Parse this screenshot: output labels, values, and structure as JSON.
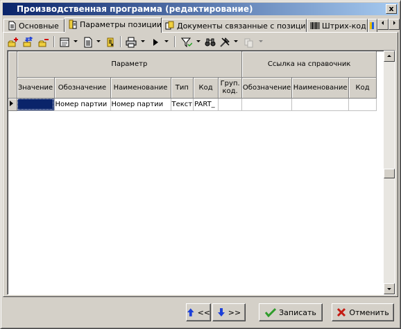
{
  "window": {
    "title": "Производственная программа (редактирование)",
    "close_glyph": "x"
  },
  "tabs": [
    {
      "label": "Основные",
      "icon": "document-icon"
    },
    {
      "label": "Параметры позиции",
      "icon": "parameters-icon"
    },
    {
      "label": "Документы связанные с позицией",
      "icon": "documents-icon"
    },
    {
      "label": "Штрих-код",
      "icon": "barcode-icon"
    }
  ],
  "toolbar": {
    "icons": [
      "add-row-icon",
      "replace-icon",
      "delete-row-icon",
      "form-icon",
      "document-icon",
      "export-icon",
      "print-icon",
      "play-icon",
      "filter-icon",
      "find-icon",
      "tools-icon",
      "copy-icon"
    ]
  },
  "grid": {
    "group_headers": {
      "parameter": "Параметр",
      "reference": "Ссылка на справочник"
    },
    "columns": [
      "Значение",
      "Обозначение",
      "Наименование",
      "Тип",
      "Код",
      "Груп. код.",
      "Обозначение",
      "Наименование",
      "Код"
    ],
    "rows": [
      [
        "",
        "Номер партии",
        "Номер партии",
        "Текст",
        "PART_",
        "",
        "",
        "",
        ""
      ]
    ]
  },
  "buttons": {
    "up_label": "<<",
    "down_label": ">>",
    "save_label": "Записать",
    "cancel_label": "Отменить"
  },
  "colors": {
    "title_start": "#0a246a",
    "title_end": "#a6caf0",
    "selection": "#0a246a",
    "button_face": "#d4d0c8",
    "arrow_blue": "#1c3fd8",
    "check_green": "#2e9c2a",
    "cross_red": "#c41a12"
  }
}
